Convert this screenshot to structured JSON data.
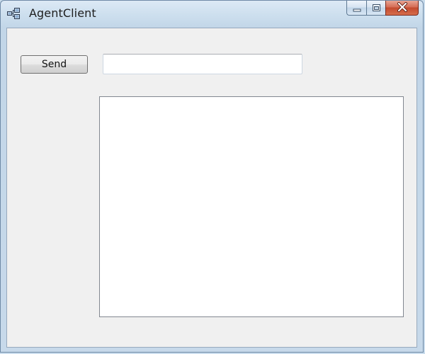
{
  "window": {
    "title": "AgentClient"
  },
  "caption_buttons": {
    "minimize_icon": "minimize-icon",
    "maximize_icon": "maximize-icon",
    "close_icon": "close-icon"
  },
  "form": {
    "send_label": "Send",
    "message_value": "",
    "output_value": ""
  }
}
